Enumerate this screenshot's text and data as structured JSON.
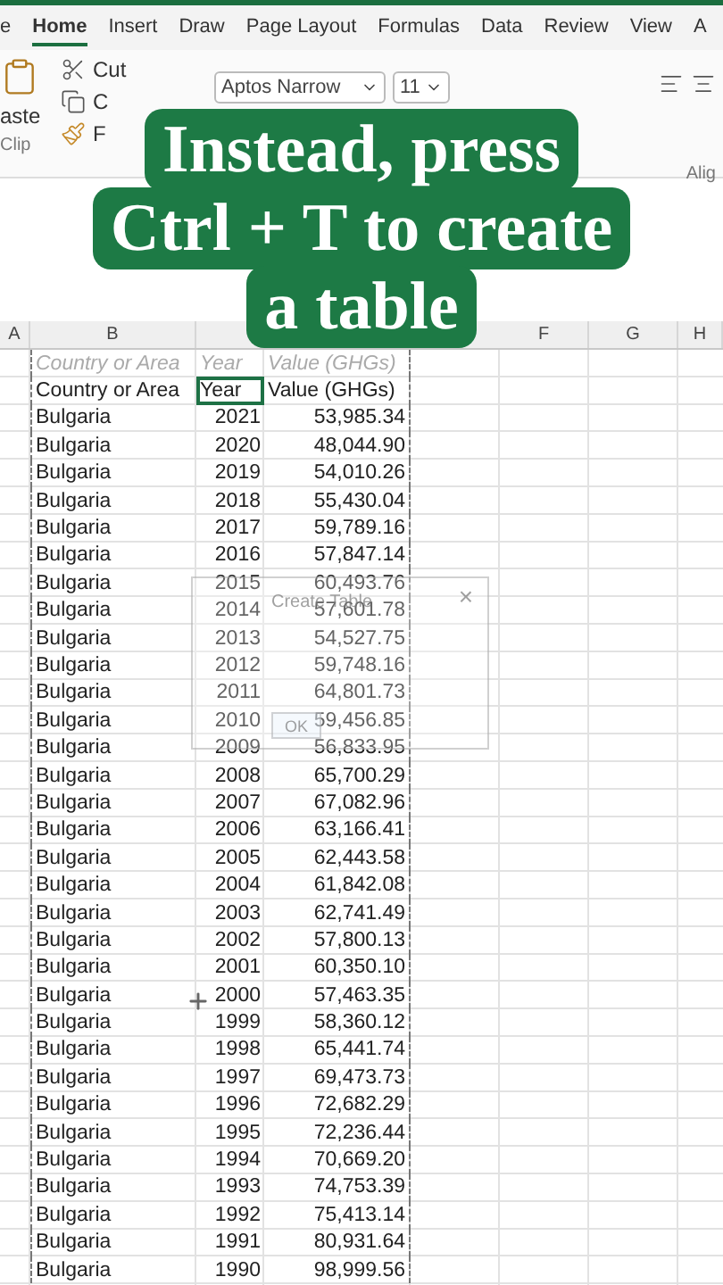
{
  "ribbon_tabs": [
    {
      "label": "e",
      "selected": false
    },
    {
      "label": "Home",
      "selected": true
    },
    {
      "label": "Insert",
      "selected": false
    },
    {
      "label": "Draw",
      "selected": false
    },
    {
      "label": "Page Layout",
      "selected": false
    },
    {
      "label": "Formulas",
      "selected": false
    },
    {
      "label": "Data",
      "selected": false
    },
    {
      "label": "Review",
      "selected": false
    },
    {
      "label": "View",
      "selected": false
    },
    {
      "label": "A",
      "selected": false
    }
  ],
  "ribbon": {
    "clipboard": {
      "paste": "aste",
      "cut": "Cut",
      "copy": "C",
      "format_painter": "F",
      "group_label": "Clip"
    },
    "font": {
      "name": "Aptos Narrow",
      "size": "11"
    },
    "alignment": {
      "group_label": "Alig"
    }
  },
  "caption": {
    "lines": [
      "Instead, press",
      "Ctrl + T to create",
      "a table"
    ]
  },
  "column_headers": [
    "A",
    "B",
    "F",
    "G",
    "H"
  ],
  "table": {
    "filter_header": [
      "Country or Area",
      "Year",
      "Value (GHGs)"
    ],
    "header": [
      {
        "label": "Country or Area",
        "selected": false
      },
      {
        "label": "Year",
        "selected": true
      },
      {
        "label": "Value (GHGs)",
        "selected": false
      }
    ],
    "rows": [
      [
        "Bulgaria",
        "2021",
        "53,985.34"
      ],
      [
        "Bulgaria",
        "2020",
        "48,044.90"
      ],
      [
        "Bulgaria",
        "2019",
        "54,010.26"
      ],
      [
        "Bulgaria",
        "2018",
        "55,430.04"
      ],
      [
        "Bulgaria",
        "2017",
        "59,789.16"
      ],
      [
        "Bulgaria",
        "2016",
        "57,847.14"
      ],
      [
        "Bulgaria",
        "2015",
        "60,493.76"
      ],
      [
        "Bulgaria",
        "2014",
        "57,601.78"
      ],
      [
        "Bulgaria",
        "2013",
        "54,527.75"
      ],
      [
        "Bulgaria",
        "2012",
        "59,748.16"
      ],
      [
        "Bulgaria",
        "2011",
        "64,801.73"
      ],
      [
        "Bulgaria",
        "2010",
        "59,456.85"
      ],
      [
        "Bulgaria",
        "2009",
        "56,833.95"
      ],
      [
        "Bulgaria",
        "2008",
        "65,700.29"
      ],
      [
        "Bulgaria",
        "2007",
        "67,082.96"
      ],
      [
        "Bulgaria",
        "2006",
        "63,166.41"
      ],
      [
        "Bulgaria",
        "2005",
        "62,443.58"
      ],
      [
        "Bulgaria",
        "2004",
        "61,842.08"
      ],
      [
        "Bulgaria",
        "2003",
        "62,741.49"
      ],
      [
        "Bulgaria",
        "2002",
        "57,800.13"
      ],
      [
        "Bulgaria",
        "2001",
        "60,350.10"
      ],
      [
        "Bulgaria",
        "2000",
        "57,463.35"
      ],
      [
        "Bulgaria",
        "1999",
        "58,360.12"
      ],
      [
        "Bulgaria",
        "1998",
        "65,441.74"
      ],
      [
        "Bulgaria",
        "1997",
        "69,473.73"
      ],
      [
        "Bulgaria",
        "1996",
        "72,682.29"
      ],
      [
        "Bulgaria",
        "1995",
        "72,236.44"
      ],
      [
        "Bulgaria",
        "1994",
        "70,669.20"
      ],
      [
        "Bulgaria",
        "1993",
        "74,753.39"
      ],
      [
        "Bulgaria",
        "1992",
        "75,413.14"
      ],
      [
        "Bulgaria",
        "1991",
        "80,931.64"
      ],
      [
        "Bulgaria",
        "1990",
        "98,999.56"
      ]
    ]
  },
  "dialog": {
    "title": "Create Table",
    "close": "×",
    "ok": "OK"
  }
}
